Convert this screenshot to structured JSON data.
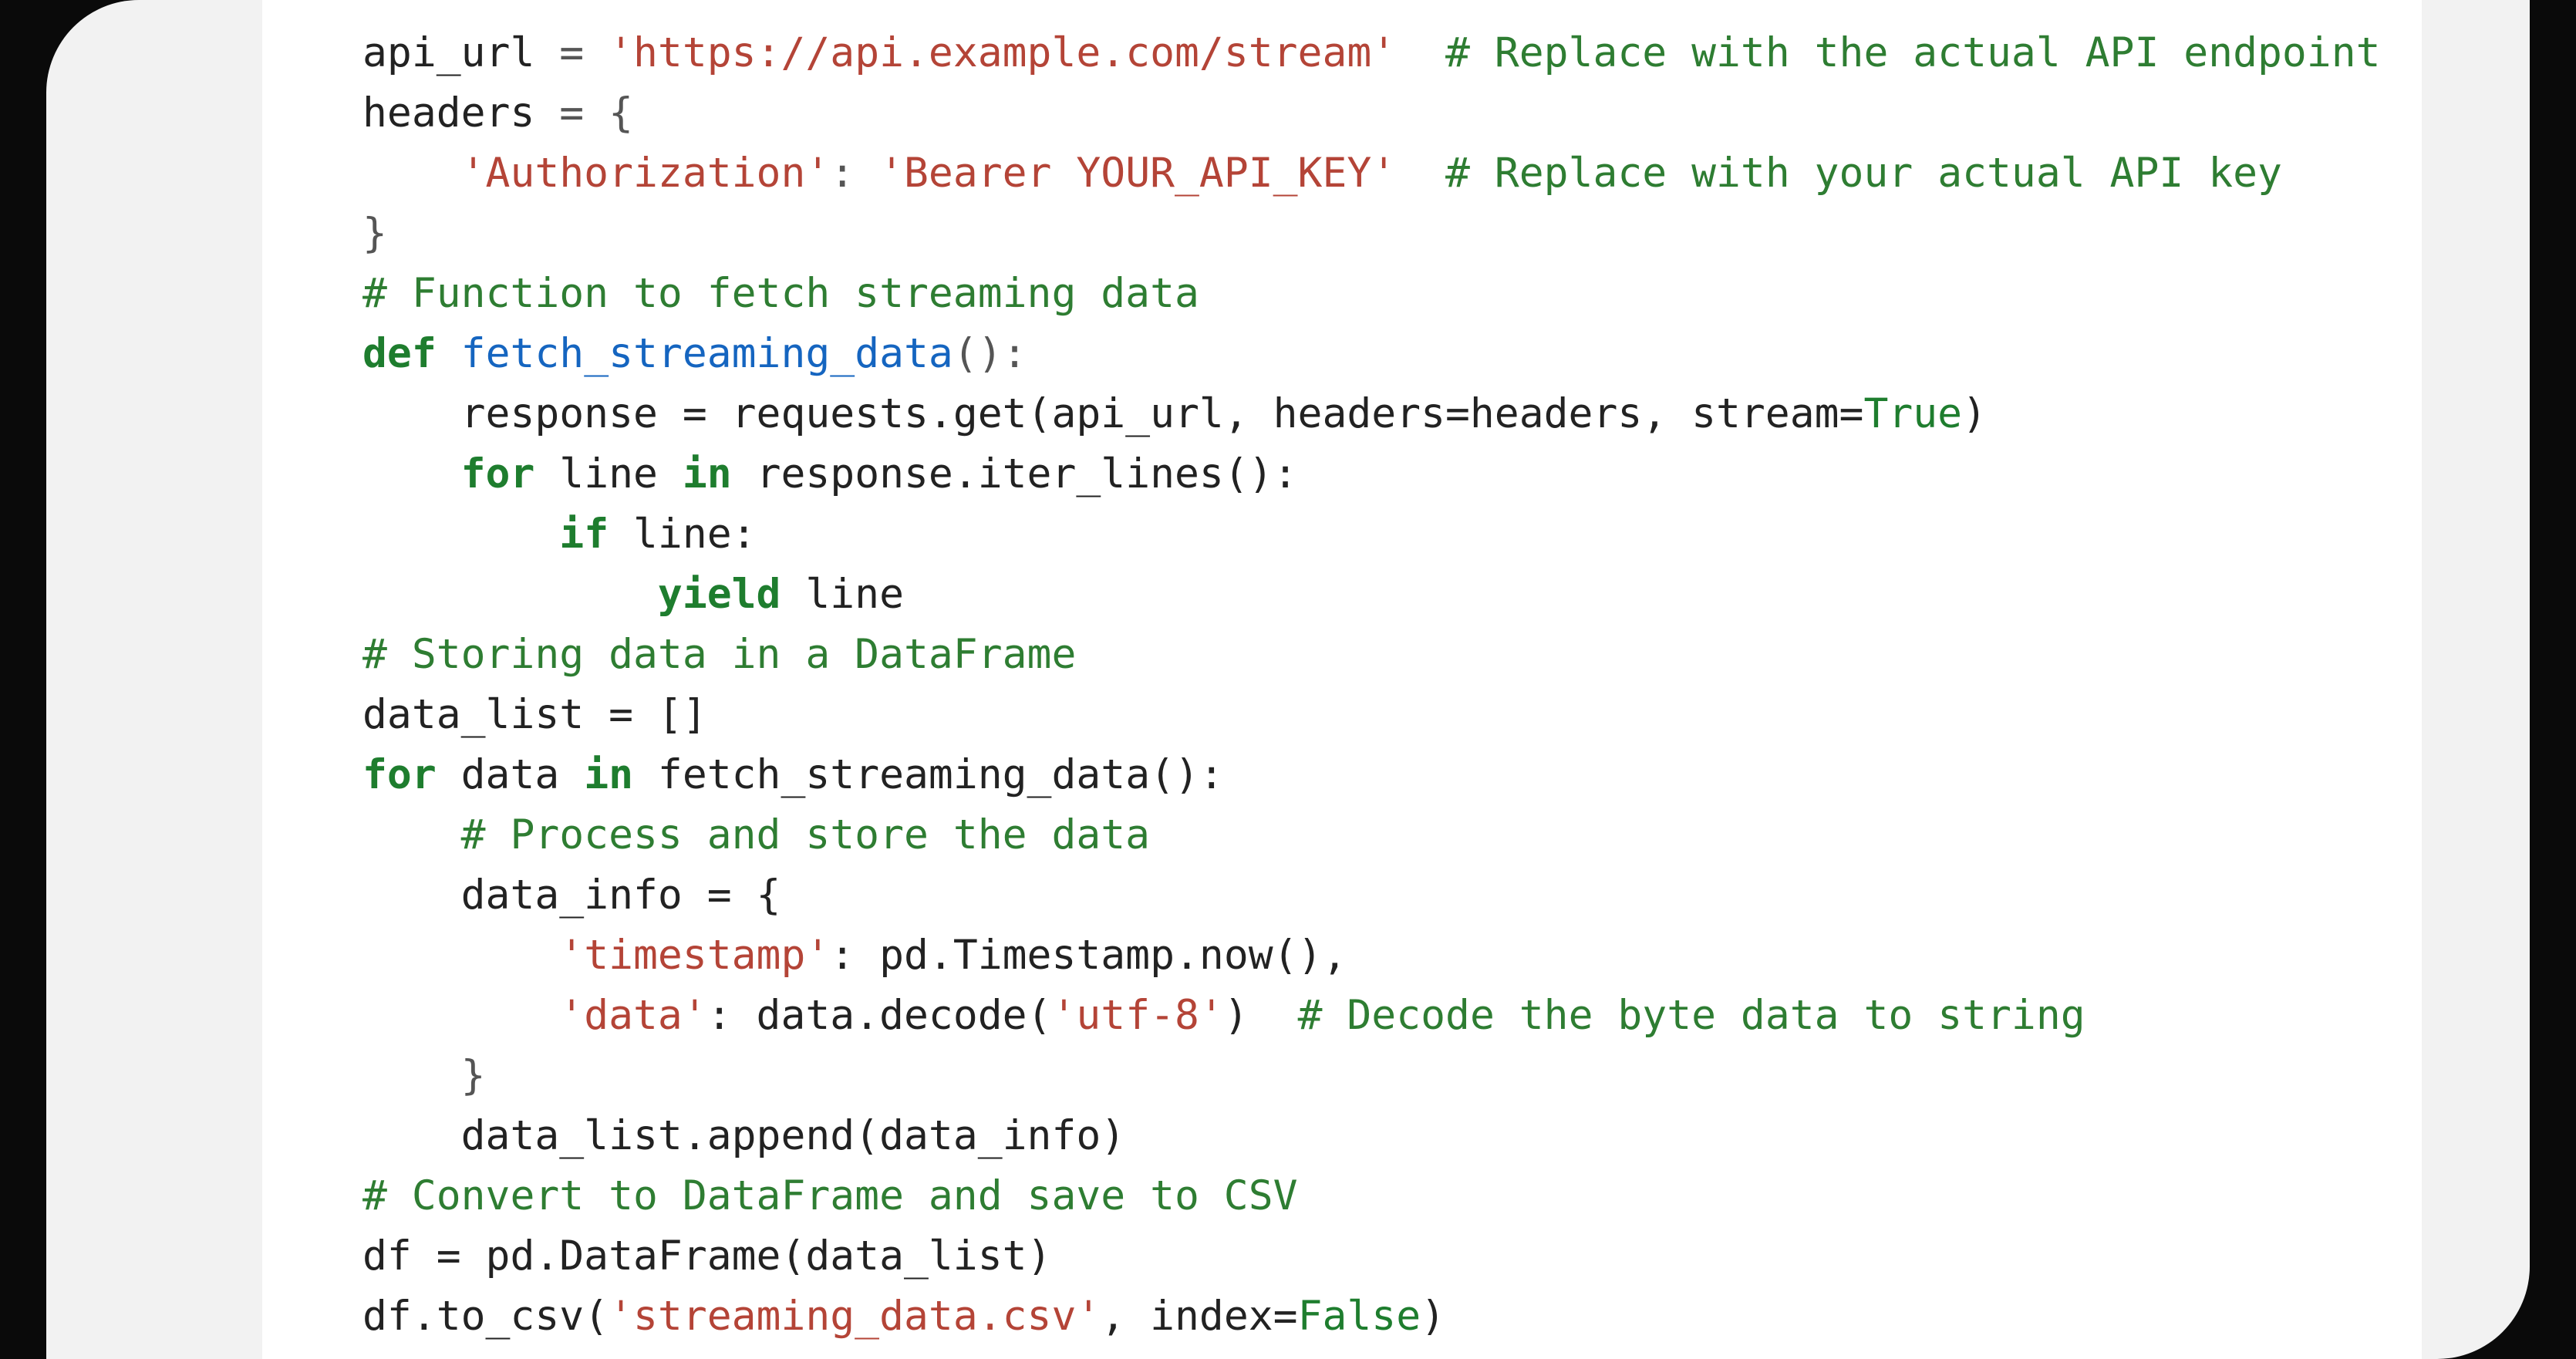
{
  "code": {
    "l1_var": "api_url",
    "l1_eq": " = ",
    "l1_str": "'https://api.example.com/stream'",
    "l1_cmt": "  # Replace with the actual API endpoint",
    "l2_var": "headers",
    "l2_eq": " = {",
    "l3_key": "'Authorization'",
    "l3_colon": ": ",
    "l3_val": "'Bearer YOUR_API_KEY'",
    "l3_cmt": "  # Replace with your actual API key",
    "l4_close": "}",
    "l5_cmt": "# Function to fetch streaming data",
    "l6_def": "def",
    "l6_sp": " ",
    "l6_name": "fetch_streaming_data",
    "l6_paren": "():",
    "l7_text1": "response = requests.get(api_url, headers=headers, stream=",
    "l7_true": "True",
    "l7_text2": ")",
    "l8_for": "for",
    "l8_text1": " line ",
    "l8_in": "in",
    "l8_text2": " response.iter_lines():",
    "l9_if": "if",
    "l9_text": " line:",
    "l10_yield": "yield",
    "l10_text": " line",
    "l11_cmt": "# Storing data in a DataFrame",
    "l12_text": "data_list = []",
    "l13_for": "for",
    "l13_text1": " data ",
    "l13_in": "in",
    "l13_text2": " fetch_streaming_data():",
    "l14_cmt": "# Process and store the data",
    "l15_text": "data_info = {",
    "l16_key": "'timestamp'",
    "l16_text": ": pd.Timestamp.now(),",
    "l17_key": "'data'",
    "l17_text1": ": data.decode(",
    "l17_arg": "'utf-8'",
    "l17_text2": ")  ",
    "l17_cmt": "# Decode the byte data to string",
    "l18_close": "}",
    "l19_text": "data_list.append(data_info)",
    "l20_cmt": "# Convert to DataFrame and save to CSV",
    "l21_text": "df = pd.DataFrame(data_list)",
    "l22_text1": "df.to_csv(",
    "l22_arg": "'streaming_data.csv'",
    "l22_text2": ", index=",
    "l22_false": "False",
    "l22_text3": ")"
  }
}
